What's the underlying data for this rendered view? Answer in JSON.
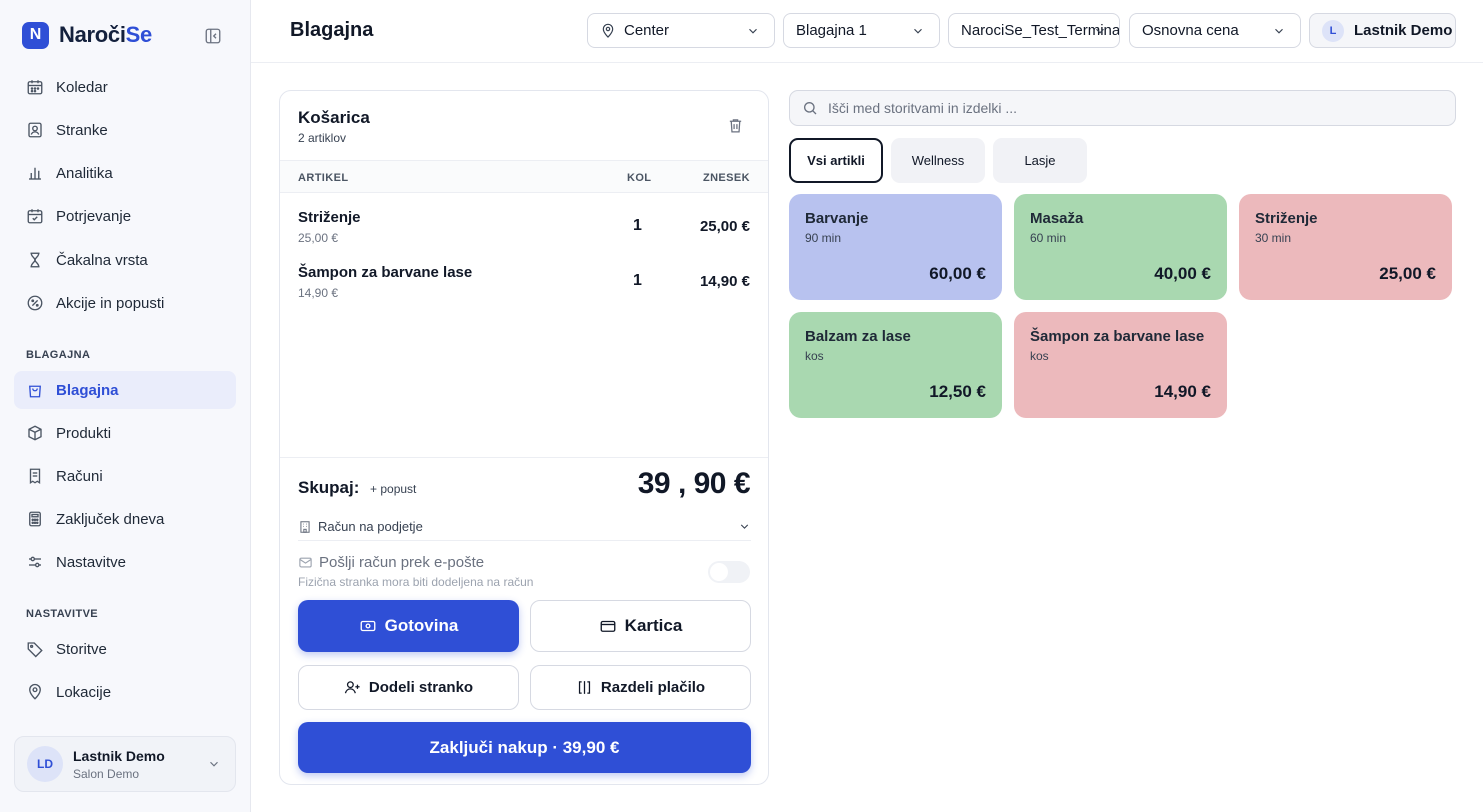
{
  "brand": {
    "logo_letter": "N",
    "name_part1": "Naroči",
    "name_part2": "Se"
  },
  "sidebar": {
    "items_main": [
      {
        "label": "Koledar",
        "icon": "calendar-icon"
      },
      {
        "label": "Stranke",
        "icon": "contacts-icon"
      },
      {
        "label": "Analitika",
        "icon": "bar-chart-icon"
      },
      {
        "label": "Potrjevanje",
        "icon": "calendar-check-icon"
      },
      {
        "label": "Čakalna vrsta",
        "icon": "hourglass-icon"
      },
      {
        "label": "Akcije in popusti",
        "icon": "discount-icon"
      }
    ],
    "section_pos": "BLAGAJNA",
    "items_pos": [
      {
        "label": "Blagajna",
        "icon": "shopping-bag-icon"
      },
      {
        "label": "Produkti",
        "icon": "package-icon"
      },
      {
        "label": "Računi",
        "icon": "receipt-icon"
      },
      {
        "label": "Zaključek dneva",
        "icon": "calculator-icon"
      },
      {
        "label": "Nastavitve",
        "icon": "sliders-icon"
      }
    ],
    "section_settings": "NASTAVITVE",
    "items_settings": [
      {
        "label": "Storitve",
        "icon": "tag-icon"
      },
      {
        "label": "Lokacije",
        "icon": "map-pin-icon"
      }
    ],
    "user": {
      "initials": "LD",
      "name": "Lastnik Demo",
      "subtitle": "Salon Demo"
    }
  },
  "header": {
    "title": "Blagajna",
    "location": "Center",
    "register": "Blagajna 1",
    "terminal": "NarociSe_Test_Terminal",
    "price_list": "Osnovna cena",
    "user_initial": "L",
    "user_name": "Lastnik Demo"
  },
  "cart": {
    "title": "Košarica",
    "count": "2 artiklov",
    "columns": {
      "item": "ARTIKEL",
      "qty": "KOL",
      "amount": "ZNESEK"
    },
    "rows": [
      {
        "name": "Striženje",
        "unit_price": "25,00 €",
        "qty": "1",
        "amount": "25,00 €"
      },
      {
        "name": "Šampon za barvane lase",
        "unit_price": "14,90 €",
        "qty": "1",
        "amount": "14,90 €"
      }
    ],
    "total_label": "Skupaj:",
    "discount_link": "+ popust",
    "total_value": "39 , 90 €",
    "invoice_company": "Račun na podjetje",
    "email_label": "Pošlji račun prek e-pošte",
    "email_note": "Fizična stranka mora biti dodeljena na račun",
    "btn_cash": "Gotovina",
    "btn_card": "Kartica",
    "btn_assign": "Dodeli stranko",
    "btn_split": "Razdeli plačilo",
    "btn_checkout": "Zaključi nakup · 39,90 €"
  },
  "catalog": {
    "search_placeholder": "Išči med storitvami in izdelki ...",
    "tabs": [
      "Vsi artikli",
      "Wellness",
      "Lasje"
    ],
    "tiles": [
      {
        "name": "Barvanje",
        "sub": "90 min",
        "price": "60,00 €",
        "color": "#b8c2ef"
      },
      {
        "name": "Masaža",
        "sub": "60 min",
        "price": "40,00 €",
        "color": "#a9d8b0"
      },
      {
        "name": "Striženje",
        "sub": "30 min",
        "price": "25,00 €",
        "color": "#ecb9bc"
      },
      {
        "name": "Balzam za lase",
        "sub": "kos",
        "price": "12,50 €",
        "color": "#a9d8b0"
      },
      {
        "name": "Šampon za barvane lase",
        "sub": "kos",
        "price": "14,90 €",
        "color": "#ecb9bc"
      }
    ]
  },
  "colors": {
    "accent": "#2f4fd6",
    "active_nav_bg": "#eaedfb"
  }
}
